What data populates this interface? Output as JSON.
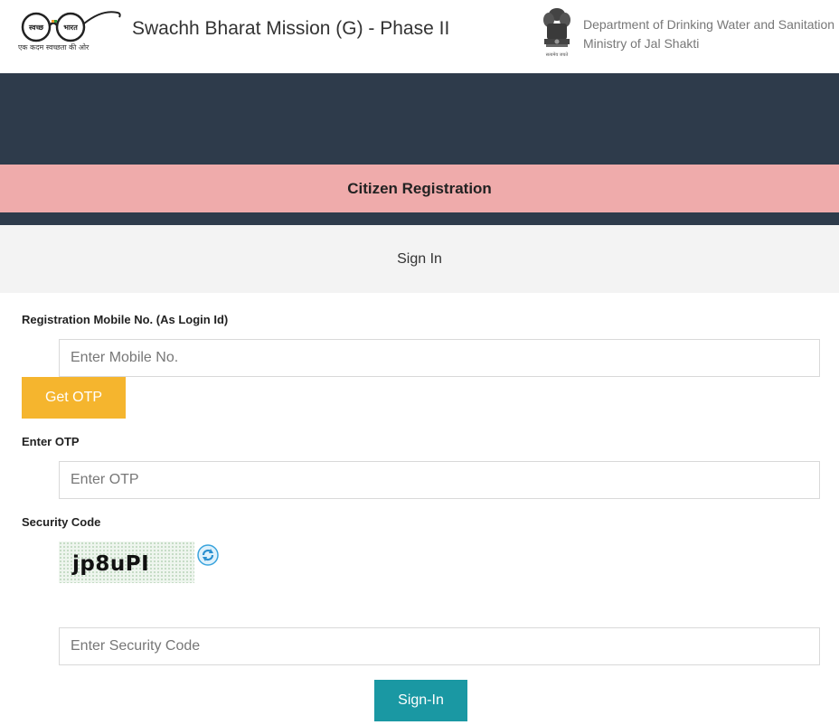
{
  "header": {
    "logo_left_text": "स्वच्छ",
    "logo_right_text": "भारत",
    "logo_tagline": "एक कदम स्वच्छता की ओर",
    "site_title": "Swachh Bharat Mission (G) - Phase II",
    "emblem_caption": "सत्यमेव जयते",
    "department": "Department of Drinking Water and Sanitation",
    "ministry": "Ministry of Jal Shakti"
  },
  "banner": {
    "title": "Citizen Registration"
  },
  "tab": {
    "label": "Sign In"
  },
  "form": {
    "mobile_label": "Registration Mobile No. (As Login Id)",
    "mobile_placeholder": "Enter Mobile No.",
    "get_otp_label": "Get OTP",
    "otp_label": "Enter OTP",
    "otp_placeholder": "Enter OTP",
    "security_label": "Security Code",
    "captcha_text": "jp8uPI",
    "security_placeholder": "Enter Security Code",
    "signin_label": "Sign-In"
  },
  "icons": {
    "refresh": "refresh-icon",
    "emblem": "national-emblem-icon",
    "logo": "swachh-bharat-glasses-icon"
  },
  "colors": {
    "dark_band": "#2e3b4b",
    "pink_band": "#efabab",
    "otp_button": "#f5b52e",
    "signin_button": "#1a98a3"
  }
}
